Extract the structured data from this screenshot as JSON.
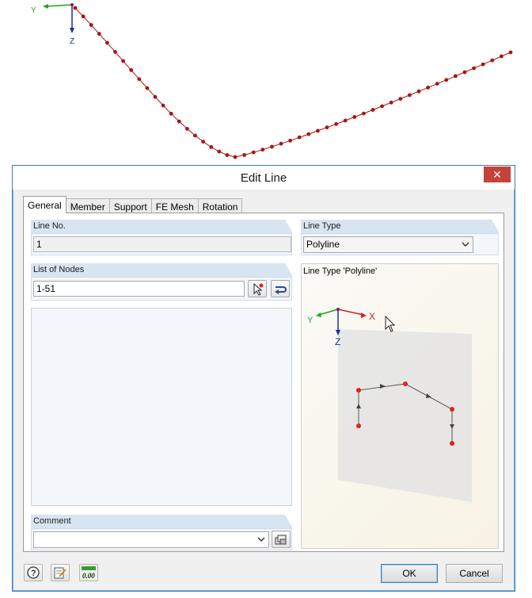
{
  "viewport": {
    "axis_y_label": "Y",
    "axis_z_label": "Z",
    "colors": {
      "line": "#9b1b1b",
      "node": "#b01010",
      "axis_y": "#22a022",
      "axis_z": "#1a2aa8"
    }
  },
  "dialog": {
    "title": "Edit Line",
    "close_icon": "close-icon",
    "tabs": [
      {
        "label": "General",
        "active": true
      },
      {
        "label": "Member",
        "active": false
      },
      {
        "label": "Support",
        "active": false
      },
      {
        "label": "FE Mesh",
        "active": false
      },
      {
        "label": "Rotation",
        "active": false
      }
    ],
    "line_no": {
      "label": "Line No.",
      "value": "1"
    },
    "line_type": {
      "label": "Line Type",
      "selected": "Polyline"
    },
    "list_of_nodes": {
      "label": "List of Nodes",
      "value": "1-51",
      "pick_icon": "pick-nodes-icon",
      "reverse_icon": "reverse-direction-icon"
    },
    "preview": {
      "label": "Line Type 'Polyline'",
      "axis_y": "Y",
      "axis_x": "X",
      "axis_z": "Z"
    },
    "comment": {
      "label": "Comment",
      "value": "",
      "library_icon": "comment-library-icon"
    },
    "footer": {
      "help_icon": "help-icon",
      "edit_icon": "edit-icon",
      "units_icon": "units-icon",
      "units_text": "0.00",
      "ok_label": "OK",
      "cancel_label": "Cancel"
    }
  }
}
